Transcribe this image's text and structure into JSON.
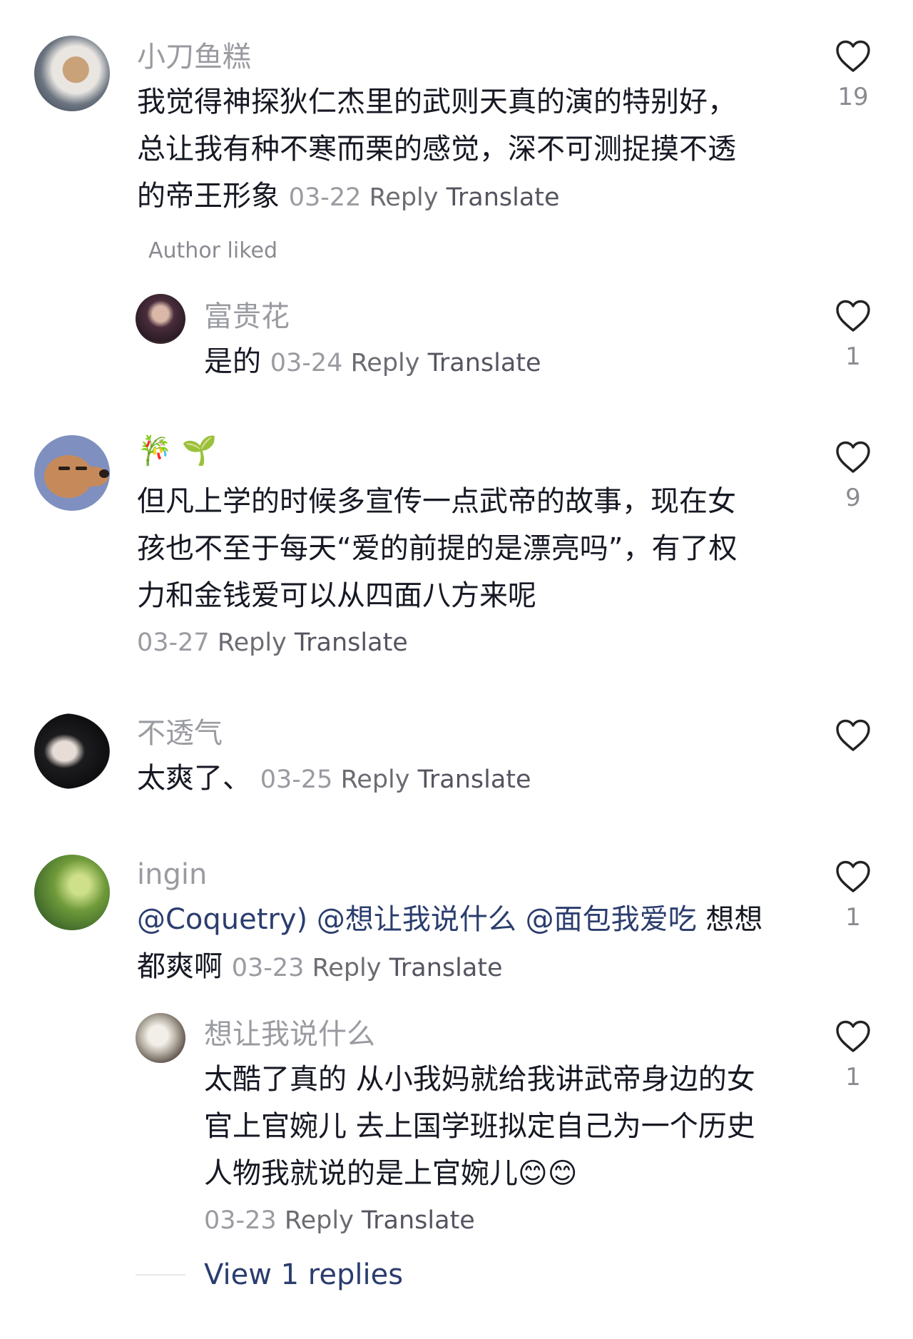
{
  "comments": [
    {
      "username": "小刀鱼糕",
      "text_lines": [
        "我觉得神探狄仁杰里的武则天真的演的特别好，",
        "总让我有种不寒而栗的感觉，深不可测捉摸不透",
        "的帝王形象"
      ],
      "date": "03-22",
      "reply_label": "Reply",
      "translate_label": "Translate",
      "likes": "19",
      "author_liked": "Author liked",
      "replies": [
        {
          "username": "富贵花",
          "text": "是的",
          "date": "03-24",
          "reply_label": "Reply",
          "translate_label": "Translate",
          "likes": "1"
        }
      ]
    },
    {
      "username": "🎋 🌱",
      "text_lines": [
        "但凡上学的时候多宣传一点武帝的故事，现在女",
        "孩也不至于每天“爱的前提的是漂亮吗”，有了权",
        "力和金钱爱可以从四面八方来呢"
      ],
      "date": "03-27",
      "reply_label": "Reply",
      "translate_label": "Translate",
      "likes": "9"
    },
    {
      "username": "不透气",
      "text": "太爽了、",
      "date": "03-25",
      "reply_label": "Reply",
      "translate_label": "Translate",
      "likes": ""
    },
    {
      "username": "ingin",
      "mentions": [
        "@Coquetry)",
        "@想让我说什么",
        "@面包我爱吃"
      ],
      "text_tail": "想想",
      "text_line2": "都爽啊",
      "date": "03-23",
      "reply_label": "Reply",
      "translate_label": "Translate",
      "likes": "1",
      "replies": [
        {
          "username": "想让我说什么",
          "text_lines": [
            "太酷了真的 从小我妈就给我讲武帝身边的女",
            "官上官婉儿 去上国学班拟定自己为一个历史",
            "人物我就说的是上官婉儿"
          ],
          "emojis": [
            "😊",
            "😊"
          ],
          "date": "03-23",
          "reply_label": "Reply",
          "translate_label": "Translate",
          "likes": "1"
        }
      ],
      "view_replies": "View 1 replies"
    }
  ],
  "colors": {
    "username": "#9a9ba1",
    "text": "#161823",
    "link": "#2b3d6e",
    "heart_stroke": "#222222"
  }
}
